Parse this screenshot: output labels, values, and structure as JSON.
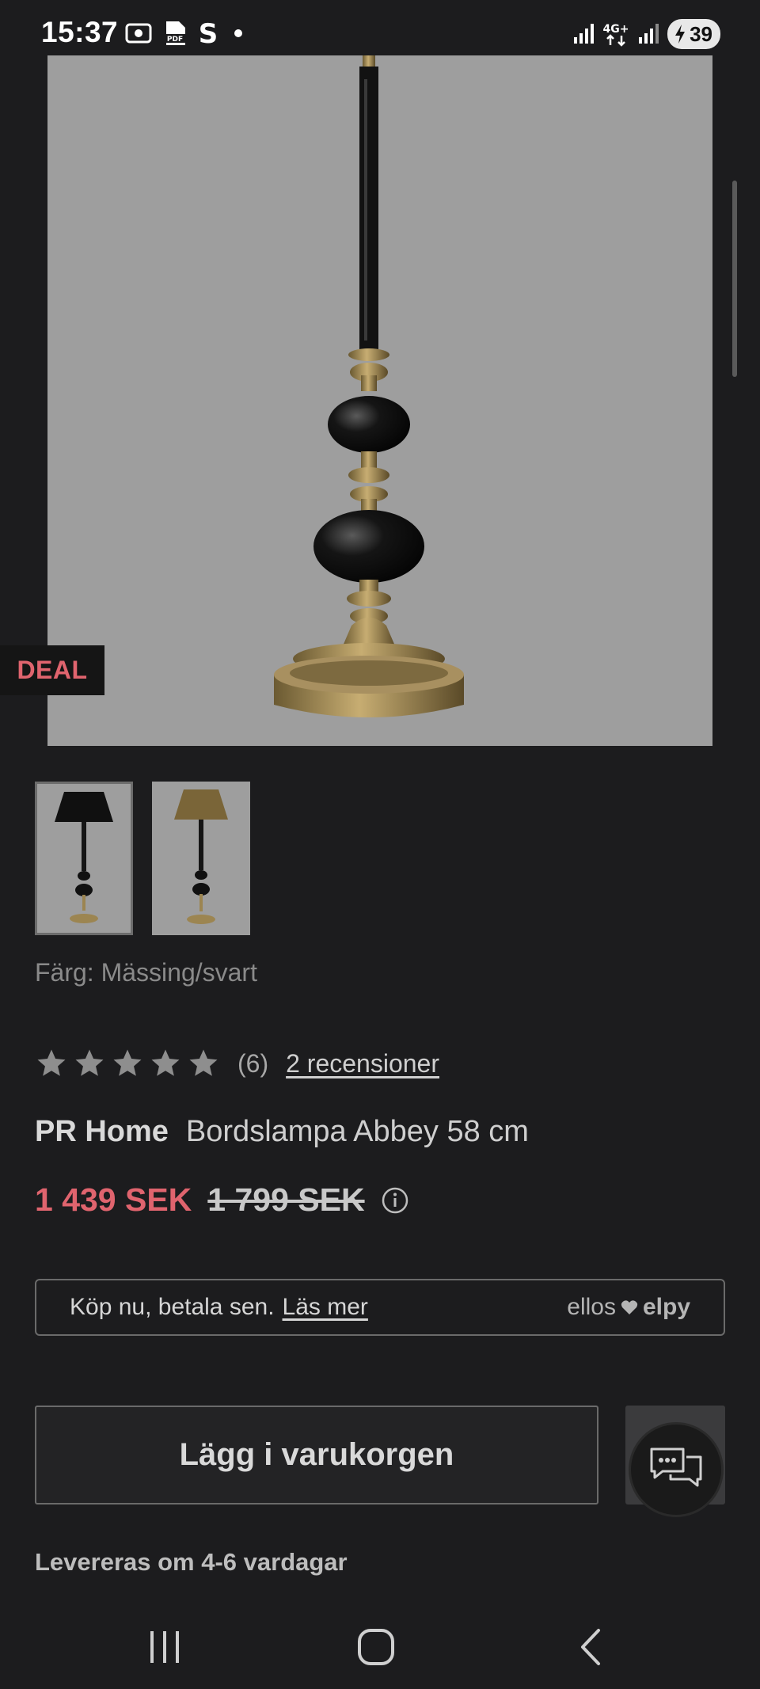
{
  "status_bar": {
    "time": "15:37",
    "network": "4G+",
    "battery": "39"
  },
  "product": {
    "badge": "DEAL",
    "color_label": "Färg: Mässing/svart",
    "rating": {
      "stars": 5,
      "count": "(6)",
      "reviews_link": "2 recensioner"
    },
    "brand": "PR Home",
    "name": "Bordslampa Abbey 58 cm",
    "price_now": "1 439 SEK",
    "price_old": "1 799 SEK"
  },
  "payment": {
    "text": "Köp nu, betala sen.",
    "link": "Läs mer",
    "brand_left": "ellos",
    "brand_right": "elpy"
  },
  "actions": {
    "add_to_cart": "Lägg i varukorgen"
  },
  "delivery": "Levereras om 4-6 vardagar",
  "colors": {
    "accent_price": "#e0646e",
    "background": "#1c1c1e"
  }
}
